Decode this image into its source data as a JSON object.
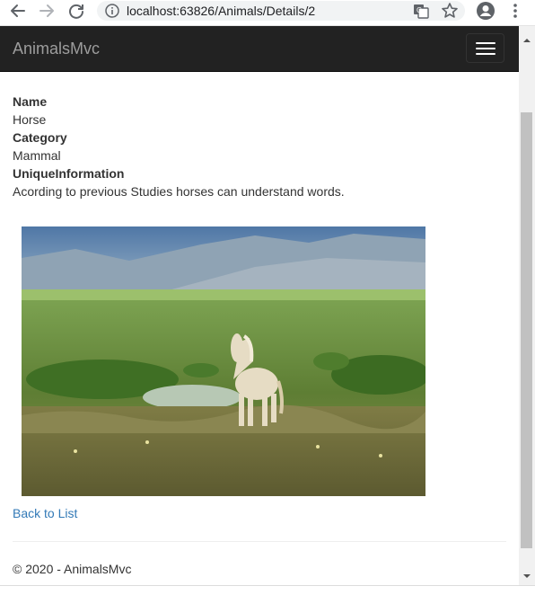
{
  "browser": {
    "url": "localhost:63826/Animals/Details/2"
  },
  "navbar": {
    "brand": "AnimalsMvc"
  },
  "details": {
    "name_label": "Name",
    "name_value": "Horse",
    "category_label": "Category",
    "category_value": "Mammal",
    "unique_label": "UniqueInformation",
    "unique_value": "Acording to previous Studies horses can understand words."
  },
  "links": {
    "back": "Back to List"
  },
  "footer": {
    "text": "© 2020 - AnimalsMvc"
  },
  "icons": {
    "back": "arrow-left-icon",
    "forward": "arrow-right-icon",
    "reload": "reload-icon",
    "info": "info-icon",
    "translate": "translate-icon",
    "bookmark": "star-icon",
    "profile": "account-icon",
    "menu": "kebab-menu-icon",
    "hamburger": "hamburger-icon"
  },
  "colors": {
    "navbar_bg": "#222222",
    "brand": "#9d9d9d",
    "link": "#337ab7"
  }
}
